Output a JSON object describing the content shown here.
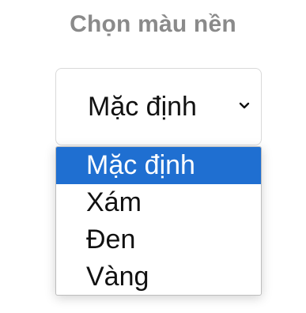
{
  "title": "Chọn màu nền",
  "select": {
    "value": "Mặc định",
    "chevron_icon": "chevron-down-icon"
  },
  "dropdown": {
    "options": [
      {
        "label": "Mặc định",
        "selected": true
      },
      {
        "label": "Xám",
        "selected": false
      },
      {
        "label": "Đen",
        "selected": false
      },
      {
        "label": "Vàng",
        "selected": false
      }
    ]
  },
  "colors": {
    "title": "#8a8a8a",
    "highlight": "#1f6fd1",
    "text": "#111111",
    "border": "#d9d9d9"
  }
}
